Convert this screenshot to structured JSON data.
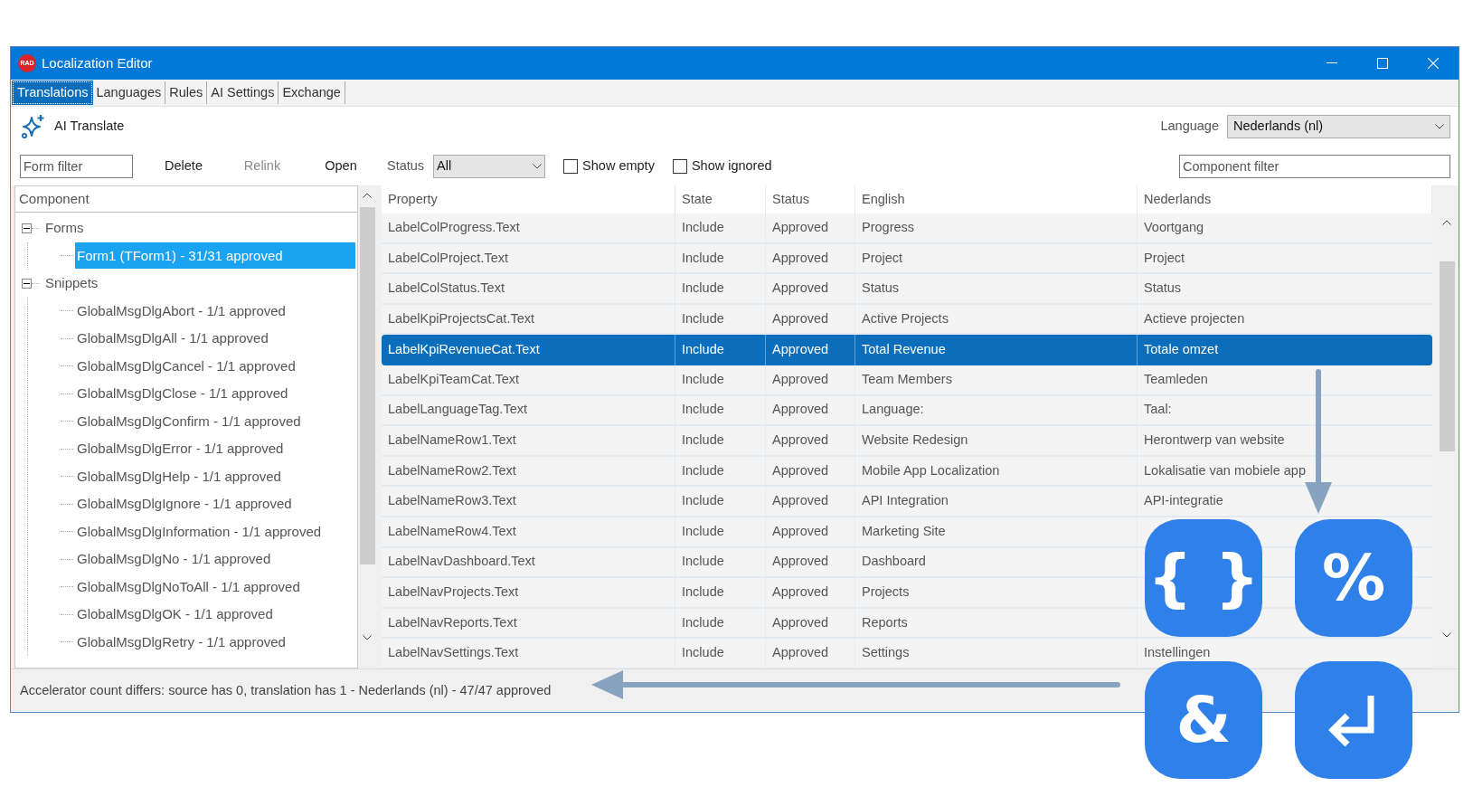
{
  "window": {
    "title": "Localization Editor",
    "app_logo": "RAD"
  },
  "tabs": [
    {
      "label": "Translations",
      "selected": true
    },
    {
      "label": "Languages",
      "selected": false
    },
    {
      "label": "Rules",
      "selected": false
    },
    {
      "label": "AI Settings",
      "selected": false
    },
    {
      "label": "Exchange",
      "selected": false
    }
  ],
  "toolbar": {
    "ai_translate": "AI Translate",
    "language_label": "Language",
    "language_value": "Nederlands (nl)"
  },
  "filter_bar": {
    "form_filter": {
      "placeholder": "Form filter"
    },
    "buttons": [
      {
        "label": "Delete",
        "disabled": false
      },
      {
        "label": "Relink",
        "disabled": true
      },
      {
        "label": "Open",
        "disabled": false
      }
    ],
    "status_label": "Status",
    "status_value": "All",
    "checkboxes": [
      {
        "label": "Show empty",
        "checked": false
      },
      {
        "label": "Show ignored",
        "checked": false
      }
    ],
    "component_filter": {
      "placeholder": "Component filter"
    }
  },
  "tree": {
    "header": "Component",
    "items": [
      {
        "label": "Forms",
        "expanded": true,
        "selected": false,
        "children": [
          {
            "label": "Form1 (TForm1)  -  31/31 approved",
            "selected": true
          }
        ]
      },
      {
        "label": "Snippets",
        "expanded": true,
        "selected": false,
        "children": [
          {
            "label": "GlobalMsgDlgAbort  -  1/1 approved",
            "selected": false
          },
          {
            "label": "GlobalMsgDlgAll  -  1/1 approved",
            "selected": false
          },
          {
            "label": "GlobalMsgDlgCancel  -  1/1 approved",
            "selected": false
          },
          {
            "label": "GlobalMsgDlgClose  -  1/1 approved",
            "selected": false
          },
          {
            "label": "GlobalMsgDlgConfirm  -  1/1 approved",
            "selected": false
          },
          {
            "label": "GlobalMsgDlgError  -  1/1 approved",
            "selected": false
          },
          {
            "label": "GlobalMsgDlgHelp  -  1/1 approved",
            "selected": false
          },
          {
            "label": "GlobalMsgDlgIgnore  -  1/1 approved",
            "selected": false
          },
          {
            "label": "GlobalMsgDlgInformation  -  1/1 approved",
            "selected": false
          },
          {
            "label": "GlobalMsgDlgNo  -  1/1 approved",
            "selected": false
          },
          {
            "label": "GlobalMsgDlgNoToAll  -  1/1 approved",
            "selected": false
          },
          {
            "label": "GlobalMsgDlgOK  -  1/1 approved",
            "selected": false
          },
          {
            "label": "GlobalMsgDlgRetry  -  1/1 approved",
            "selected": false
          }
        ]
      }
    ]
  },
  "table": {
    "columns": [
      "Property",
      "State",
      "Status",
      "English",
      "Nederlands"
    ],
    "rows": [
      {
        "cells": [
          "LabelColProgress.Text",
          "Include",
          "Approved",
          "Progress",
          "Voortgang"
        ],
        "selected": false
      },
      {
        "cells": [
          "LabelColProject.Text",
          "Include",
          "Approved",
          "Project",
          "Project"
        ],
        "selected": false
      },
      {
        "cells": [
          "LabelColStatus.Text",
          "Include",
          "Approved",
          "Status",
          "Status"
        ],
        "selected": false
      },
      {
        "cells": [
          "LabelKpiProjectsCat.Text",
          "Include",
          "Approved",
          "Active Projects",
          "Actieve projecten"
        ],
        "selected": false
      },
      {
        "cells": [
          "LabelKpiRevenueCat.Text",
          "Include",
          "Approved",
          "Total Revenue",
          "Totale omzet"
        ],
        "selected": true
      },
      {
        "cells": [
          "LabelKpiTeamCat.Text",
          "Include",
          "Approved",
          "Team Members",
          "Teamleden"
        ],
        "selected": false
      },
      {
        "cells": [
          "LabelLanguageTag.Text",
          "Include",
          "Approved",
          "Language:",
          "Taal:"
        ],
        "selected": false
      },
      {
        "cells": [
          "LabelNameRow1.Text",
          "Include",
          "Approved",
          "Website Redesign",
          "Herontwerp van website"
        ],
        "selected": false
      },
      {
        "cells": [
          "LabelNameRow2.Text",
          "Include",
          "Approved",
          "Mobile App Localization",
          "Lokalisatie van mobiele app"
        ],
        "selected": false
      },
      {
        "cells": [
          "LabelNameRow3.Text",
          "Include",
          "Approved",
          "API Integration",
          "API-integratie"
        ],
        "selected": false
      },
      {
        "cells": [
          "LabelNameRow4.Text",
          "Include",
          "Approved",
          "Marketing Site"
        ],
        "selected": false
      },
      {
        "cells": [
          "LabelNavDashboard.Text",
          "Include",
          "Approved",
          "Dashboard"
        ],
        "selected": false
      },
      {
        "cells": [
          "LabelNavProjects.Text",
          "Include",
          "Approved",
          "Projects"
        ],
        "selected": false
      },
      {
        "cells": [
          "LabelNavReports.Text",
          "Include",
          "Approved",
          "Reports"
        ],
        "selected": false
      },
      {
        "cells": [
          "LabelNavSettings.Text",
          "Include",
          "Approved",
          "Settings",
          "Instellingen"
        ],
        "selected": false
      }
    ]
  },
  "status_bar": "Accelerator count differs: source has 0, translation has 1 - Nederlands (nl) - 47/47 approved",
  "badges": [
    {
      "kind": "text",
      "symbol": "{ }"
    },
    {
      "kind": "text",
      "symbol": "%"
    },
    {
      "kind": "text",
      "symbol": "&"
    },
    {
      "kind": "enter"
    }
  ]
}
